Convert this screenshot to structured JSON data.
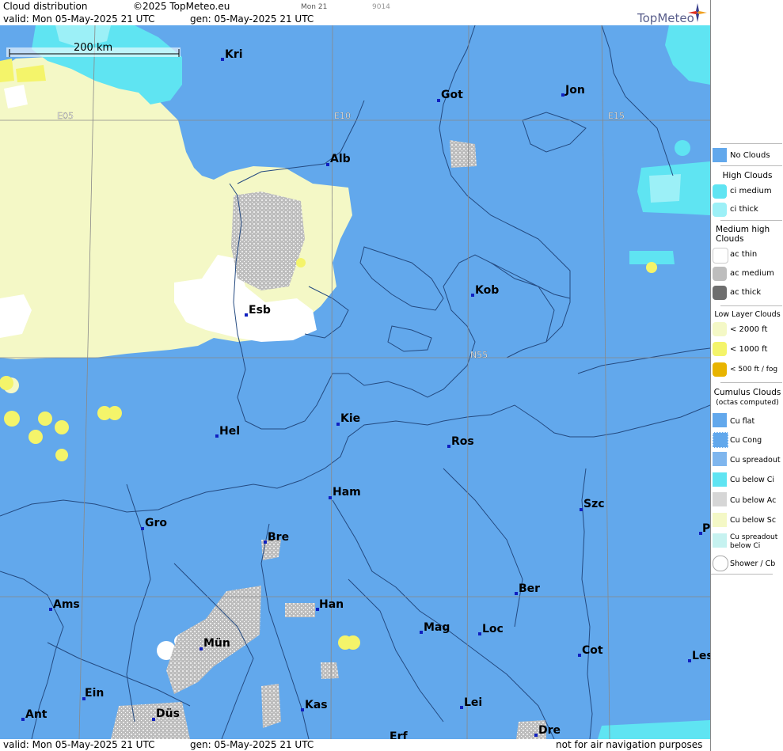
{
  "header": {
    "product": "Cloud distribution",
    "copyright": "©2025 TopMeteo.eu",
    "day_small": "Mon 21",
    "code_small": "9014",
    "valid_line": "valid:  Mon  05-May-2025  21 UTC",
    "gen_line": "gen: 05-May-2025 21 UTC",
    "brand": "TopMeteo"
  },
  "footer": {
    "valid_line": "valid:  Mon  05-May-2025  21 UTC",
    "gen_line": "gen: 05-May-2025 21 UTC",
    "disclaimer": "not for air navigation purposes"
  },
  "map": {
    "scale_label": "200 km",
    "grid_labels": [
      "E05",
      "E10",
      "E15",
      "N55"
    ],
    "cities": [
      "Kri",
      "Got",
      "Jon",
      "Alb",
      "Esb",
      "Kob",
      "Kie",
      "Hel",
      "Ros",
      "Ham",
      "Szc",
      "Gro",
      "Bre",
      "Ber",
      "Ams",
      "Han",
      "Mag",
      "Loc",
      "Mün",
      "Cot",
      "Les",
      "Ein",
      "Kas",
      "Lei",
      "Ant",
      "Düs",
      "Dre",
      "Erf",
      "P"
    ]
  },
  "legend": {
    "no_clouds": "No Clouds",
    "high_clouds": "High Clouds",
    "ci_medium": "ci medium",
    "ci_thick": "ci thick",
    "medium_high": "Medium high Clouds",
    "ac_thin": "ac thin",
    "ac_medium": "ac medium",
    "ac_thick": "ac thick",
    "low_layer": "Low Layer Clouds",
    "lt2000": "< 2000 ft",
    "lt1000": "< 1000 ft",
    "lt500": "< 500 ft / fog",
    "cumulus": "Cumulus Clouds",
    "octas": "(octas computed)",
    "cu_flat": "Cu flat",
    "cu_cong": "Cu Cong",
    "cu_spreadout": "Cu spreadout",
    "cu_below_ci": "Cu below Ci",
    "cu_below_ac": "Cu below Ac",
    "cu_below_sc": "Cu below Sc",
    "cu_spreadout_below_ci": "Cu spreadout below Ci",
    "shower_cb": "Shower / Cb"
  },
  "colors": {
    "no_clouds": "#62a8ec",
    "ci_medium": "#5fe4f2",
    "ci_thick": "#9cf0f7",
    "low_2000": "#f4f8c6",
    "low_1000": "#f4f46a",
    "fog": "#e8b400",
    "ac_medium": "#bdbdbd",
    "ac_thick": "#6e6e6e"
  }
}
